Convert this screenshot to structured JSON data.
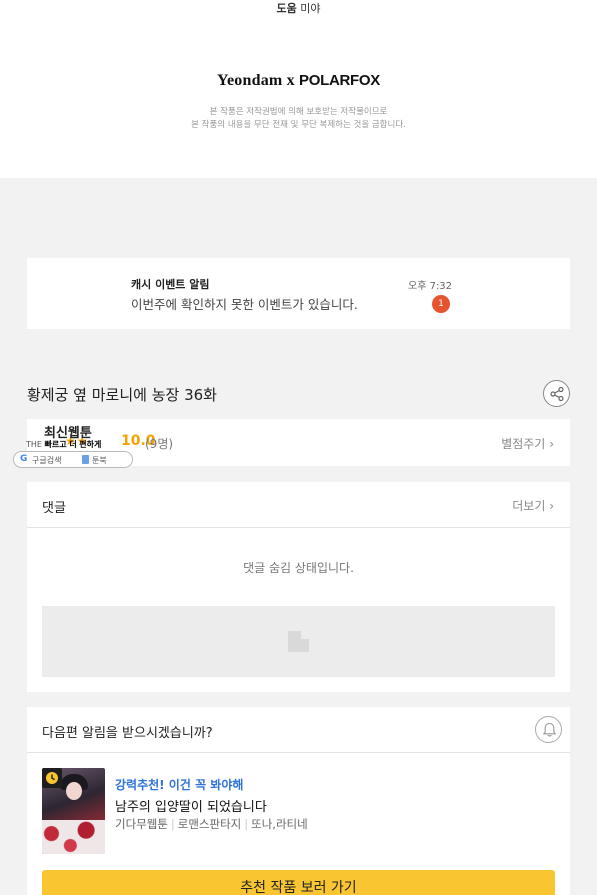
{
  "header": {
    "credit_name": "도움",
    "credit_person": "미야",
    "logo_brand": "Yeondam",
    "logo_x": "x",
    "logo_partner": "POLARFOX",
    "copyright_line1": "본 작품은 저작권법에 의해 보호받는 저작물이므로",
    "copyright_line2": "본 작품의 내용을 무단 전재 및 무단 복제하는 것을 금합니다."
  },
  "notification": {
    "title": "캐시 이벤트 알림",
    "message": "이번주에 확인하지 못한 이벤트가 있습니다.",
    "time": "오후 7:32",
    "badge_count": "1"
  },
  "episode": {
    "title": "황제궁 옆 마로니에 농장 36화",
    "share_icon": "share-icon"
  },
  "rating": {
    "stars": "★★",
    "score": "10.0",
    "count": "(9명)",
    "rate_link": "별점주기",
    "score_fraction": 1.0
  },
  "overlay": {
    "title": "최신웹툰",
    "subtitle_prefix": "THE",
    "subtitle_mid": "빠르고 더",
    "subtitle_end": "편하게",
    "google_label": "구글검색",
    "bookmark_label": "툰북"
  },
  "comments": {
    "label": "댓글",
    "more": "더보기",
    "hidden_message": "댓글 숨김 상태입니다."
  },
  "next_episode": {
    "question": "다음편 알림을 받으시겠습니까?",
    "bell_icon": "bell-icon",
    "rec_label": "강력추천! 이건 꼭 봐야해",
    "rec_title": "남주의 입양딸이 되었습니다",
    "rec_meta": [
      "기다무웹툰",
      "로맨스판타지",
      "또나,라티네"
    ],
    "cta": "추천 작품 보러 가기"
  },
  "colors": {
    "accent_yellow": "#f9c531",
    "badge_red": "#e5532f",
    "star_orange": "#f2a300",
    "link_blue": "#2f73d9"
  }
}
